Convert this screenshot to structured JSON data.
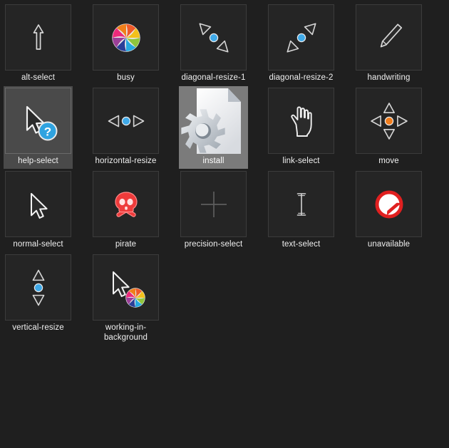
{
  "window": {
    "background_color": "#1f1f1f",
    "tile_background_color": "#252525",
    "tile_border_color": "#3c3c3c",
    "selected_color": "#4a4a4a",
    "selected_strong_color": "#7b7b7b",
    "label_color": "#f0f0f0",
    "accent_blue": "#3fa9e8",
    "accent_orange": "#f07c1c",
    "accent_red": "#ee3b3b",
    "columns": 5,
    "rows": 4
  },
  "items": [
    {
      "label": "alt-select",
      "icon": "alt-select-cursor-icon",
      "state": "normal"
    },
    {
      "label": "busy",
      "icon": "busy-spinner-icon",
      "state": "normal"
    },
    {
      "label": "diagonal-resize-1",
      "icon": "diagonal-resize-nwse-icon",
      "state": "normal"
    },
    {
      "label": "diagonal-resize-2",
      "icon": "diagonal-resize-nesw-icon",
      "state": "normal"
    },
    {
      "label": "handwriting",
      "icon": "pencil-icon",
      "state": "normal"
    },
    {
      "label": "help-select",
      "icon": "help-cursor-icon",
      "state": "selected"
    },
    {
      "label": "horizontal-resize",
      "icon": "horizontal-resize-icon",
      "state": "normal"
    },
    {
      "label": "install",
      "icon": "install-document-gear-icon",
      "state": "selected-strong"
    },
    {
      "label": "link-select",
      "icon": "pointing-hand-icon",
      "state": "normal"
    },
    {
      "label": "move",
      "icon": "move-four-arrows-icon",
      "state": "normal"
    },
    {
      "label": "normal-select",
      "icon": "arrow-cursor-icon",
      "state": "normal"
    },
    {
      "label": "pirate",
      "icon": "skull-crossbones-icon",
      "state": "normal"
    },
    {
      "label": "precision-select",
      "icon": "crosshair-icon",
      "state": "normal"
    },
    {
      "label": "text-select",
      "icon": "text-ibeam-icon",
      "state": "normal"
    },
    {
      "label": "unavailable",
      "icon": "no-entry-icon",
      "state": "normal"
    },
    {
      "label": "vertical-resize",
      "icon": "vertical-resize-icon",
      "state": "normal"
    },
    {
      "label": "working-in-background",
      "icon": "working-in-background-icon",
      "state": "normal"
    }
  ]
}
